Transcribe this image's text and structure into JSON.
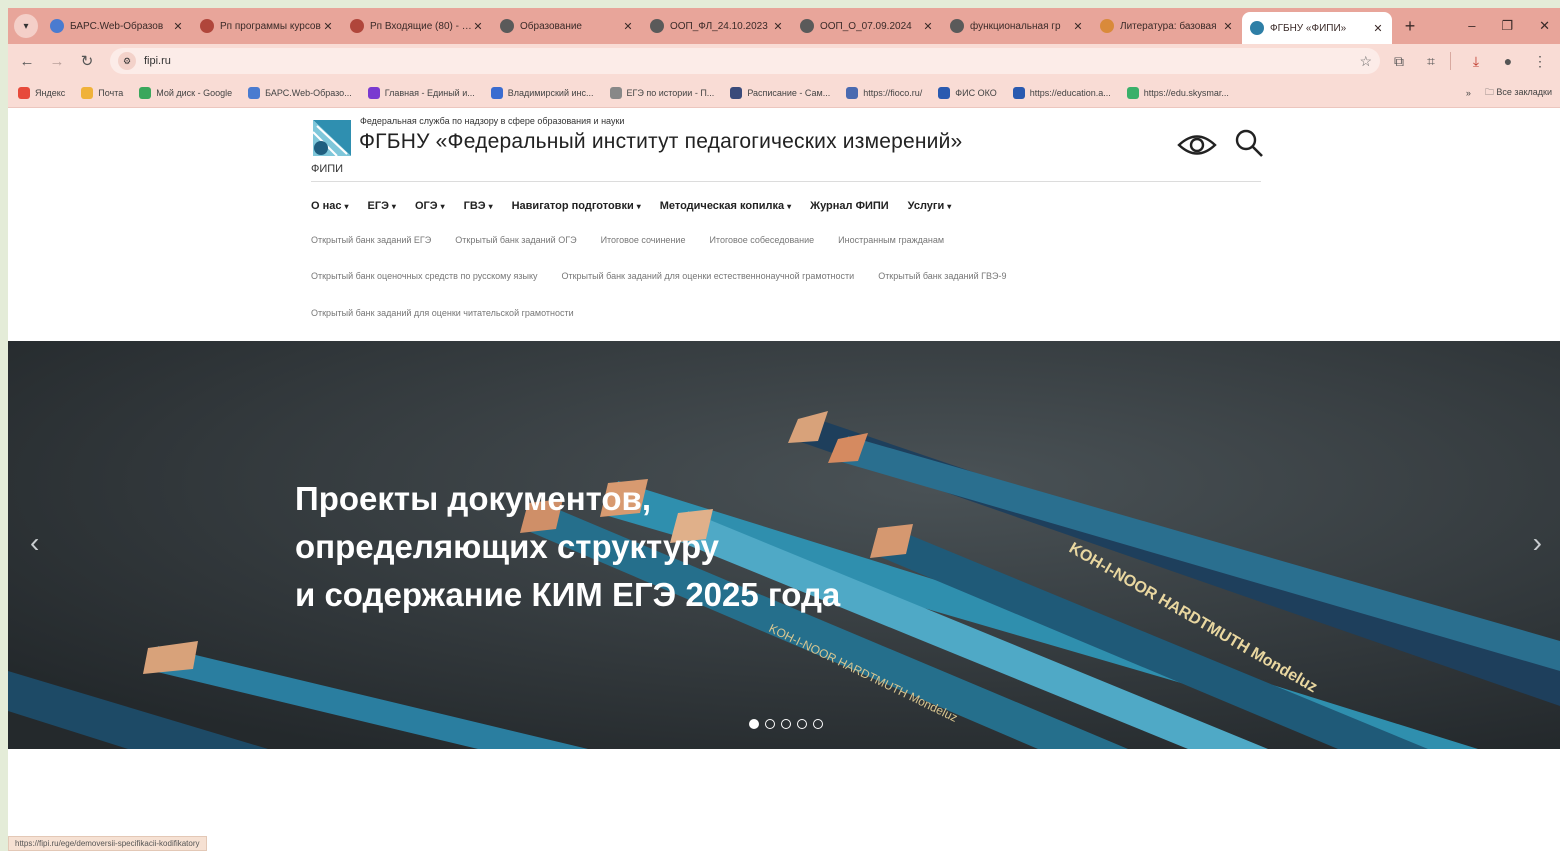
{
  "browser": {
    "tabs": [
      {
        "title": "БАРС.Web-Образов",
        "icon_color": "#4a7bd0"
      },
      {
        "title": "Рп программы курсов",
        "icon_color": "#b0463b"
      },
      {
        "title": "Рп Входящие (80) - a.i",
        "icon_color": "#b0463b"
      },
      {
        "title": "Образование",
        "icon_color": "#5a5a5a"
      },
      {
        "title": "ООП_ФЛ_24.10.2023",
        "icon_color": "#5a5a5a"
      },
      {
        "title": "ООП_О_07.09.2024",
        "icon_color": "#5a5a5a"
      },
      {
        "title": "функциональная гр",
        "icon_color": "#5a5a5a"
      },
      {
        "title": "Литература: базовая",
        "icon_color": "#d98a3a"
      },
      {
        "title": "ФГБНУ «ФИПИ»",
        "icon_color": "#2e7fa6",
        "active": true
      }
    ],
    "new_tab": "+",
    "address": "fipi.ru",
    "bookmarks": [
      {
        "label": "Яндекс",
        "color": "#e74a3b"
      },
      {
        "label": "Почта",
        "color": "#f0b23a"
      },
      {
        "label": "Мой диск - Google",
        "color": "#3aa75c"
      },
      {
        "label": "БАРС.Web-Образо...",
        "color": "#4a7bd0"
      },
      {
        "label": "Главная - Единый и...",
        "color": "#7a3ad0"
      },
      {
        "label": "Владимирский инс...",
        "color": "#3a6cd0"
      },
      {
        "label": "ЕГЭ по истории - П...",
        "color": "#888888"
      },
      {
        "label": "Расписание - Сам...",
        "color": "#3a4a7a"
      },
      {
        "label": "https://fioco.ru/",
        "color": "#4a6ab0"
      },
      {
        "label": "ФИС ОКО",
        "color": "#2a5ab0"
      },
      {
        "label": "https://education.a...",
        "color": "#2a5ab0"
      },
      {
        "label": "https://edu.skysmar...",
        "color": "#3ab06a"
      }
    ],
    "all_bookmarks": "Все закладки",
    "status_url": "https://fipi.ru/ege/demoversii-specifikacii-kodifikatory"
  },
  "site": {
    "org_subtitle": "Федеральная служба по надзору в сфере образования и науки",
    "org_title": "ФГБНУ «Федеральный институт педагогических измерений»",
    "org_short": "ФИПИ",
    "nav": [
      {
        "label": "О нас",
        "caret": true
      },
      {
        "label": "ЕГЭ",
        "caret": true
      },
      {
        "label": "ОГЭ",
        "caret": true
      },
      {
        "label": "ГВЭ",
        "caret": true
      },
      {
        "label": "Навигатор подготовки",
        "caret": true
      },
      {
        "label": "Методическая копилка",
        "caret": true
      },
      {
        "label": "Журнал ФИПИ",
        "caret": false
      },
      {
        "label": "Услуги",
        "caret": true
      }
    ],
    "quicklinks_row1": [
      "Открытый банк заданий ЕГЭ",
      "Открытый банк заданий ОГЭ",
      "Итоговое сочинение",
      "Итоговое собеседование",
      "Иностранным гражданам"
    ],
    "quicklinks_row2": [
      "Открытый банк оценочных средств по русскому языку",
      "Открытый банк заданий для оценки естественнонаучной грамотности",
      "Открытый банк заданий ГВЭ-9"
    ],
    "quicklinks_row3": [
      "Открытый банк заданий для оценки читательской грамотности"
    ]
  },
  "hero": {
    "title_lines": [
      "Проекты документов,",
      "определяющих структуру",
      "и содержание КИМ ЕГЭ 2025 года"
    ],
    "pencil_text_1": "KOH-I-NOOR HARDTMUTH Mondeluz",
    "pencil_text_2": "KOH-I-NOOR HARDTMUTH Mondeluz",
    "slide_count": 5,
    "active_slide": 1
  }
}
